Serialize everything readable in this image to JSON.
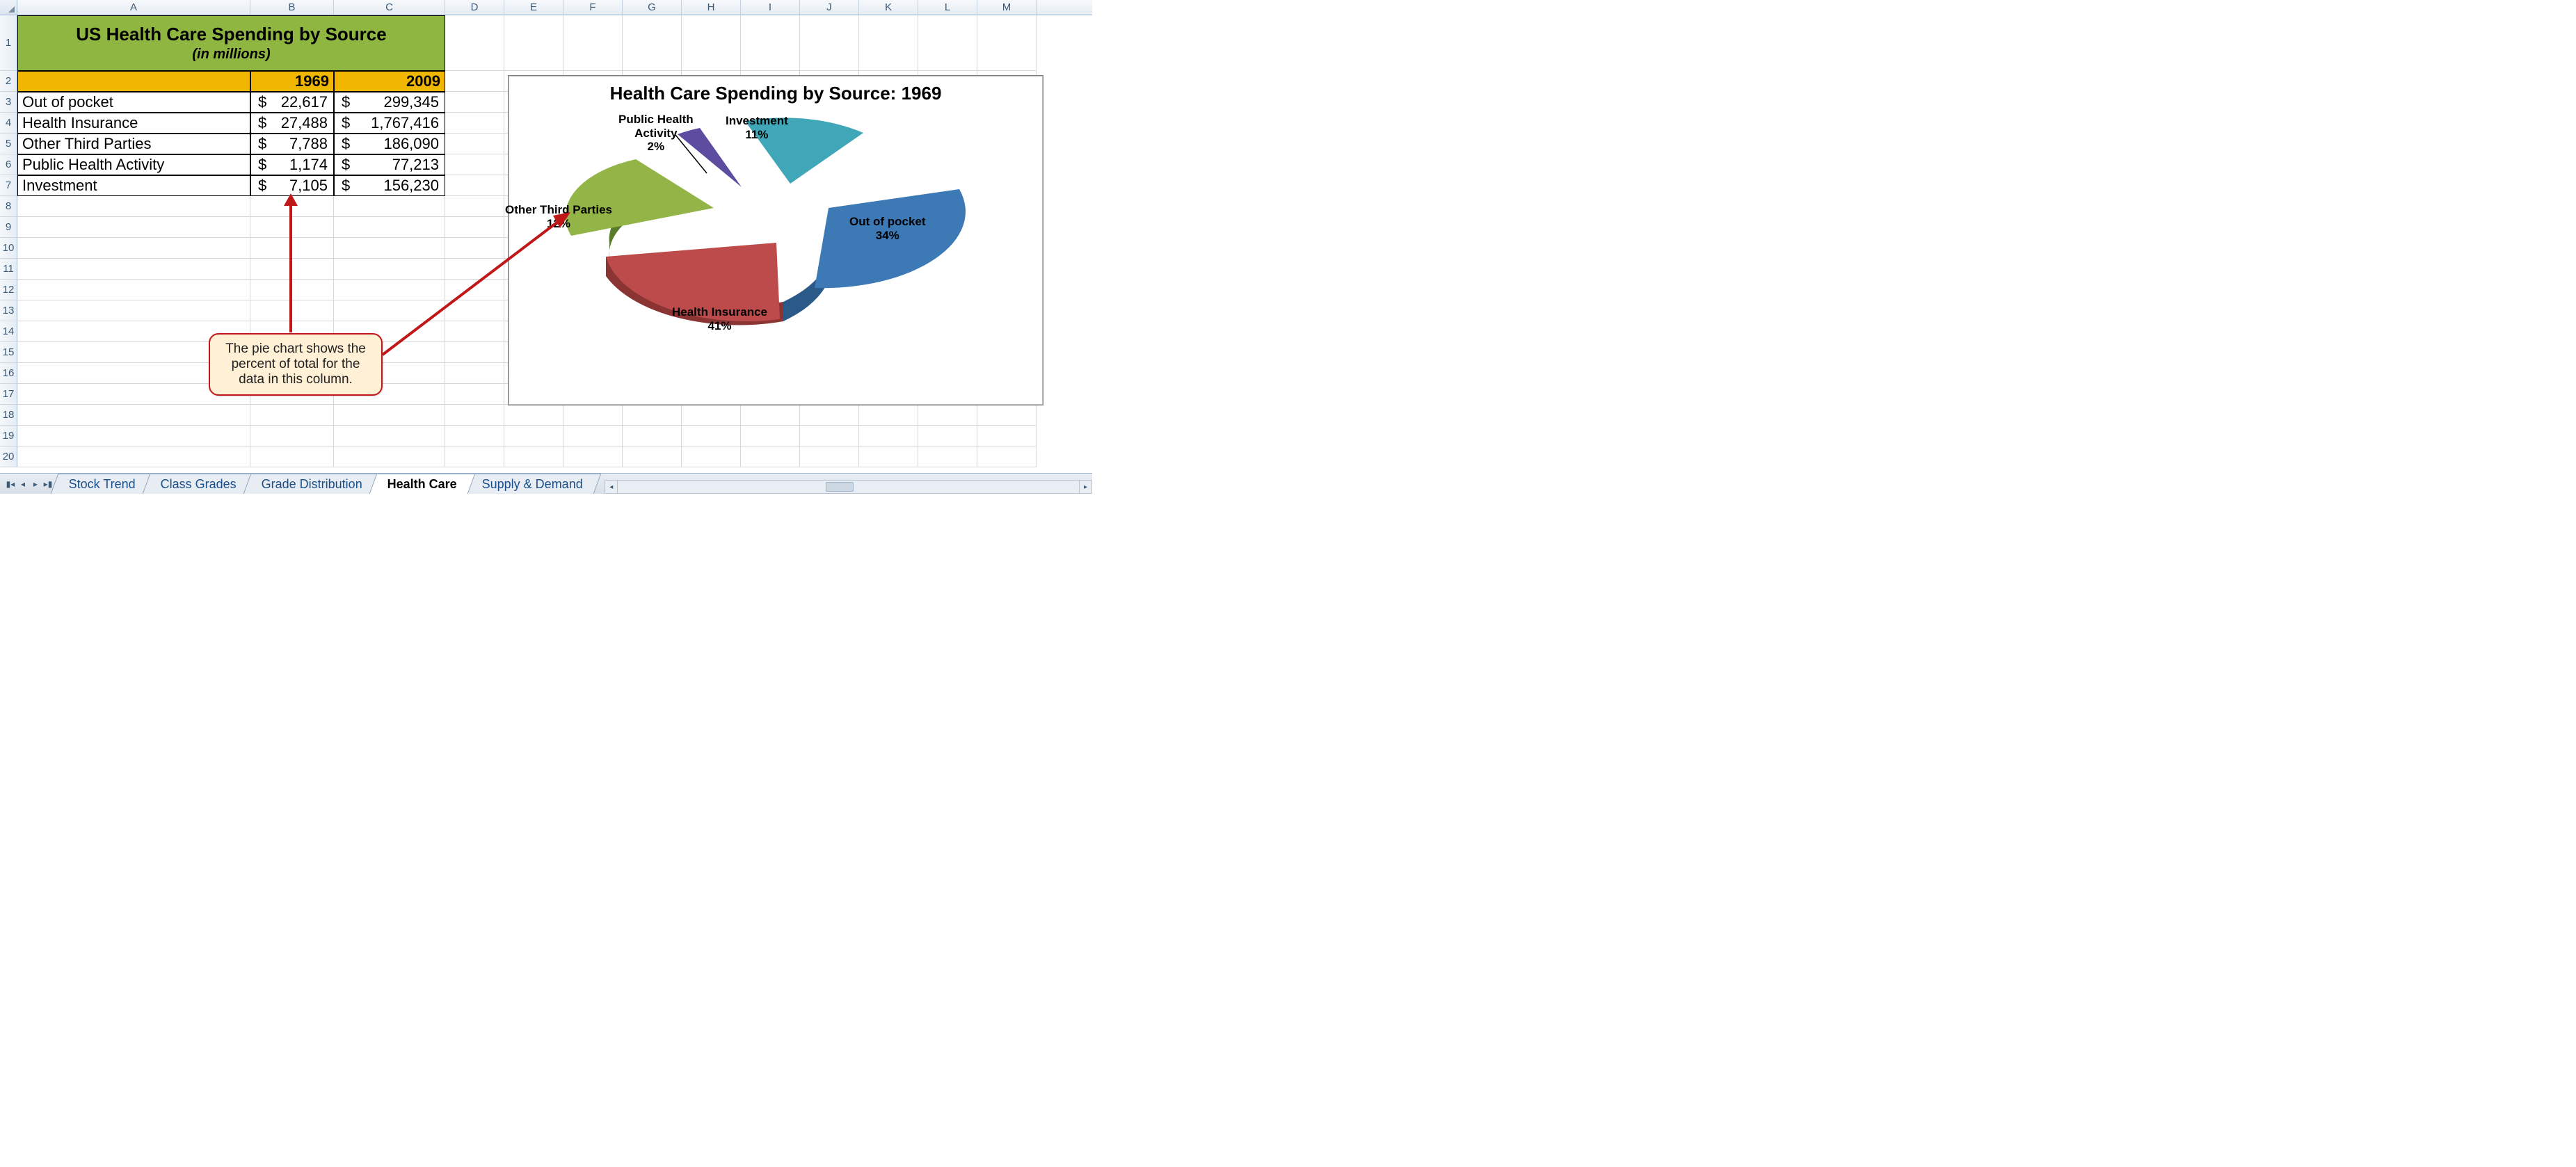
{
  "columns": [
    "A",
    "B",
    "C",
    "D",
    "E",
    "F",
    "G",
    "H",
    "I",
    "J",
    "K",
    "L",
    "M"
  ],
  "col_widths": {
    "A": 335,
    "B": 120,
    "C": 160,
    "D": 85,
    "rest": 85
  },
  "row_labels": [
    "1",
    "2",
    "3",
    "4",
    "5",
    "6",
    "7",
    "8",
    "9",
    "10",
    "11",
    "12",
    "13",
    "14",
    "15",
    "16",
    "17",
    "18",
    "19",
    "20"
  ],
  "title": {
    "main": "US Health Care Spending by Source",
    "sub": "(in millions)"
  },
  "year_headers": {
    "b": "1969",
    "c": "2009"
  },
  "rows": [
    {
      "label": "Out of pocket",
      "b": "22,617",
      "c": "299,345"
    },
    {
      "label": "Health Insurance",
      "b": "27,488",
      "c": "1,767,416"
    },
    {
      "label": "Other Third Parties",
      "b": "7,788",
      "c": "186,090"
    },
    {
      "label": "Public Health Activity",
      "b": "1,174",
      "c": "77,213"
    },
    {
      "label": "Investment",
      "b": "7,105",
      "c": "156,230"
    }
  ],
  "dollar": "$",
  "chart_title": "Health Care Spending by Source: 1969",
  "pie_labels": {
    "out": "Out of pocket",
    "out_pct": "34%",
    "hi": "Health Insurance",
    "hi_pct": "41%",
    "ot": "Other Third Parties",
    "ot_pct": "12%",
    "ph": "Public Health",
    "ph2": "Activity",
    "ph_pct": "2%",
    "inv": "Investment",
    "inv_pct": "11%"
  },
  "callout_text": "The pie chart shows the percent of total for the data in this column.",
  "tabs": [
    "Stock Trend",
    "Class Grades",
    "Grade Distribution",
    "Health Care",
    "Supply & Demand"
  ],
  "active_tab": "Health Care",
  "chart_data": {
    "type": "pie",
    "title": "Health Care Spending by Source: 1969",
    "series": [
      {
        "name": "1969",
        "slices": [
          {
            "label": "Out of pocket",
            "value": 22617,
            "percent": 34
          },
          {
            "label": "Health Insurance",
            "value": 27488,
            "percent": 41
          },
          {
            "label": "Other Third Parties",
            "value": 7788,
            "percent": 12
          },
          {
            "label": "Public Health Activity",
            "value": 1174,
            "percent": 2
          },
          {
            "label": "Investment",
            "value": 7105,
            "percent": 11
          }
        ]
      }
    ],
    "exploded": true,
    "three_d": true
  }
}
